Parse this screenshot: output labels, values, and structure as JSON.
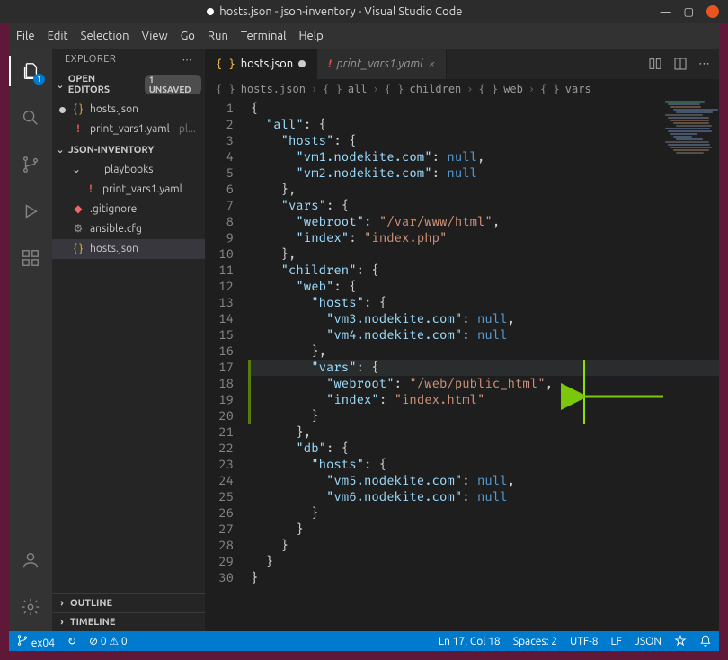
{
  "titlebar": {
    "title": "hosts.json - json-inventory - Visual Studio Code"
  },
  "menu": [
    "File",
    "Edit",
    "Selection",
    "View",
    "Go",
    "Run",
    "Terminal",
    "Help"
  ],
  "sidebar": {
    "header": "EXPLORER",
    "openEditors": {
      "label": "OPEN EDITORS",
      "badge": "1 UNSAVED",
      "items": [
        {
          "icon": "json",
          "name": "hosts.json",
          "modified": true
        },
        {
          "icon": "yaml",
          "name": "print_vars1.yaml",
          "suffix": "pl..."
        }
      ]
    },
    "workspace": {
      "label": "JSON-INVENTORY",
      "items": [
        {
          "icon": "fold",
          "name": "playbooks",
          "depth": 1,
          "chev": "⌄"
        },
        {
          "icon": "yaml",
          "name": "print_vars1.yaml",
          "depth": 2
        },
        {
          "icon": "git",
          "name": ".gitignore",
          "depth": 1
        },
        {
          "icon": "cfg",
          "name": "ansible.cfg",
          "depth": 1
        },
        {
          "icon": "json",
          "name": "hosts.json",
          "depth": 1,
          "selected": true
        }
      ]
    },
    "outline": "OUTLINE",
    "timeline": "TIMELINE"
  },
  "tabs": [
    {
      "icon": "json",
      "label": "hosts.json",
      "active": true,
      "dirty": true
    },
    {
      "icon": "yaml",
      "label": "print_vars1.yaml",
      "active": false,
      "dirty": false
    }
  ],
  "breadcrumb": [
    "hosts.json",
    "all",
    "children",
    "web",
    "vars"
  ],
  "code": {
    "lines": 30,
    "highlight": 17,
    "diff_ranges": [
      [
        17,
        20
      ]
    ],
    "tall_cursor": {
      "from": 17,
      "to": 20,
      "col": 44
    },
    "tokens": [
      [
        {
          "t": "{",
          "c": "punc"
        }
      ],
      [
        {
          "t": "  ",
          "c": "punc"
        },
        {
          "t": "\"all\"",
          "c": "key"
        },
        {
          "t": ": {",
          "c": "punc"
        }
      ],
      [
        {
          "t": "    ",
          "c": "punc"
        },
        {
          "t": "\"hosts\"",
          "c": "key"
        },
        {
          "t": ": {",
          "c": "punc"
        }
      ],
      [
        {
          "t": "      ",
          "c": "punc"
        },
        {
          "t": "\"vm1.nodekite.com\"",
          "c": "key"
        },
        {
          "t": ": ",
          "c": "punc"
        },
        {
          "t": "null",
          "c": "null"
        },
        {
          "t": ",",
          "c": "punc"
        }
      ],
      [
        {
          "t": "      ",
          "c": "punc"
        },
        {
          "t": "\"vm2.nodekite.com\"",
          "c": "key"
        },
        {
          "t": ": ",
          "c": "punc"
        },
        {
          "t": "null",
          "c": "null"
        }
      ],
      [
        {
          "t": "    },",
          "c": "punc"
        }
      ],
      [
        {
          "t": "    ",
          "c": "punc"
        },
        {
          "t": "\"vars\"",
          "c": "key"
        },
        {
          "t": ": {",
          "c": "punc"
        }
      ],
      [
        {
          "t": "      ",
          "c": "punc"
        },
        {
          "t": "\"webroot\"",
          "c": "key"
        },
        {
          "t": ": ",
          "c": "punc"
        },
        {
          "t": "\"/var/www/html\"",
          "c": "str"
        },
        {
          "t": ",",
          "c": "punc"
        }
      ],
      [
        {
          "t": "      ",
          "c": "punc"
        },
        {
          "t": "\"index\"",
          "c": "key"
        },
        {
          "t": ": ",
          "c": "punc"
        },
        {
          "t": "\"index.php\"",
          "c": "str"
        }
      ],
      [
        {
          "t": "    },",
          "c": "punc"
        }
      ],
      [
        {
          "t": "    ",
          "c": "punc"
        },
        {
          "t": "\"children\"",
          "c": "key"
        },
        {
          "t": ": {",
          "c": "punc"
        }
      ],
      [
        {
          "t": "      ",
          "c": "punc"
        },
        {
          "t": "\"web\"",
          "c": "key"
        },
        {
          "t": ": {",
          "c": "punc"
        }
      ],
      [
        {
          "t": "        ",
          "c": "punc"
        },
        {
          "t": "\"hosts\"",
          "c": "key"
        },
        {
          "t": ": {",
          "c": "punc"
        }
      ],
      [
        {
          "t": "          ",
          "c": "punc"
        },
        {
          "t": "\"vm3.nodekite.com\"",
          "c": "key"
        },
        {
          "t": ": ",
          "c": "punc"
        },
        {
          "t": "null",
          "c": "null"
        },
        {
          "t": ",",
          "c": "punc"
        }
      ],
      [
        {
          "t": "          ",
          "c": "punc"
        },
        {
          "t": "\"vm4.nodekite.com\"",
          "c": "key"
        },
        {
          "t": ": ",
          "c": "punc"
        },
        {
          "t": "null",
          "c": "null"
        }
      ],
      [
        {
          "t": "        },",
          "c": "punc"
        }
      ],
      [
        {
          "t": "        ",
          "c": "punc"
        },
        {
          "t": "\"vars\"",
          "c": "key"
        },
        {
          "t": ": {",
          "c": "punc"
        }
      ],
      [
        {
          "t": "          ",
          "c": "punc"
        },
        {
          "t": "\"webroot\"",
          "c": "key"
        },
        {
          "t": ": ",
          "c": "punc"
        },
        {
          "t": "\"/web/public_html\"",
          "c": "str"
        },
        {
          "t": ",",
          "c": "punc"
        }
      ],
      [
        {
          "t": "          ",
          "c": "punc"
        },
        {
          "t": "\"index\"",
          "c": "key"
        },
        {
          "t": ": ",
          "c": "punc"
        },
        {
          "t": "\"index.html\"",
          "c": "str"
        }
      ],
      [
        {
          "t": "        }",
          "c": "punc"
        }
      ],
      [
        {
          "t": "      },",
          "c": "punc"
        }
      ],
      [
        {
          "t": "      ",
          "c": "punc"
        },
        {
          "t": "\"db\"",
          "c": "key"
        },
        {
          "t": ": {",
          "c": "punc"
        }
      ],
      [
        {
          "t": "        ",
          "c": "punc"
        },
        {
          "t": "\"hosts\"",
          "c": "key"
        },
        {
          "t": ": {",
          "c": "punc"
        }
      ],
      [
        {
          "t": "          ",
          "c": "punc"
        },
        {
          "t": "\"vm5.nodekite.com\"",
          "c": "key"
        },
        {
          "t": ": ",
          "c": "punc"
        },
        {
          "t": "null",
          "c": "null"
        },
        {
          "t": ",",
          "c": "punc"
        }
      ],
      [
        {
          "t": "          ",
          "c": "punc"
        },
        {
          "t": "\"vm6.nodekite.com\"",
          "c": "key"
        },
        {
          "t": ": ",
          "c": "punc"
        },
        {
          "t": "null",
          "c": "null"
        }
      ],
      [
        {
          "t": "        }",
          "c": "punc"
        }
      ],
      [
        {
          "t": "      }",
          "c": "punc"
        }
      ],
      [
        {
          "t": "    }",
          "c": "punc"
        }
      ],
      [
        {
          "t": "  }",
          "c": "punc"
        }
      ],
      [
        {
          "t": "}",
          "c": "punc"
        }
      ]
    ]
  },
  "statusbar": {
    "branch": "ex04",
    "sync": "↻",
    "problems": "⊘ 0 ⚠ 0",
    "lncol": "Ln 17, Col 18",
    "spaces": "Spaces: 2",
    "encoding": "UTF-8",
    "eol": "LF",
    "lang": "JSON"
  }
}
